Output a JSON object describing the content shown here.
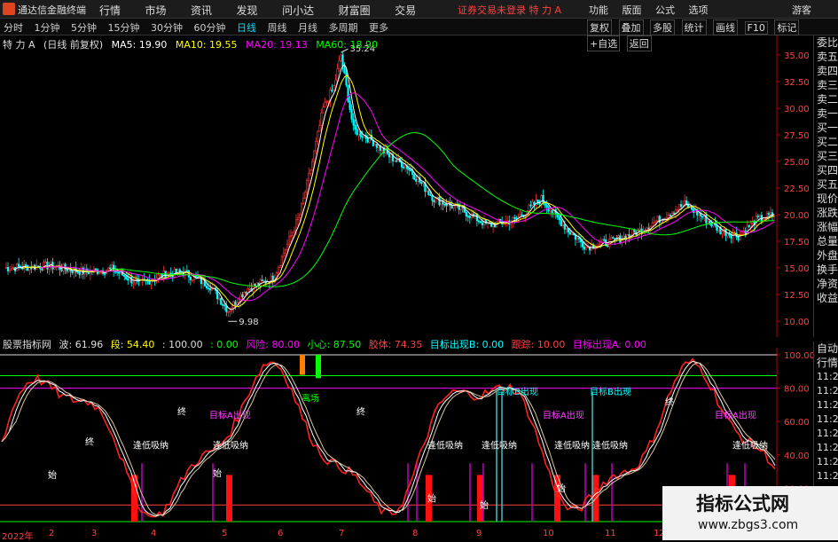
{
  "app": {
    "name": "通达信金融终端"
  },
  "menu": [
    "行情",
    "市场",
    "资讯",
    "发现",
    "问小达",
    "财富圈",
    "交易"
  ],
  "login_status": "证券交易未登录  特 力 A",
  "right_menu": [
    "功能",
    "版面",
    "公式",
    "选项"
  ],
  "guest": "游客",
  "periods": [
    "分时",
    "1分钟",
    "5分钟",
    "15分钟",
    "30分钟",
    "60分钟",
    "日线",
    "周线",
    "月线",
    "多周期",
    "更多"
  ],
  "active_period": "日线",
  "tool_buttons": [
    "复权",
    "叠加",
    "多股",
    "统计",
    "画线",
    "F10",
    "标记",
    "+自选",
    "返回"
  ],
  "main_info": {
    "stock": "特 力 A",
    "adjust": "(日线 前复权)",
    "ma5": "MA5: 19.90",
    "ma10": "MA10: 19.55",
    "ma20": "MA20: 19.13",
    "ma60": "MA60: 18.90"
  },
  "colors": {
    "up": "#ff3030",
    "down": "#00ffff",
    "ma5": "#ffffff",
    "ma10": "#ffff00",
    "ma20": "#ff00ff",
    "ma60": "#00ff00",
    "axis": "#ff4040"
  },
  "price_axis": [
    "35.00",
    "32.50",
    "30.00",
    "27.50",
    "25.00",
    "22.50",
    "20.00",
    "17.50",
    "15.00",
    "12.50",
    "10.00"
  ],
  "price_annotations": {
    "high": "35.24",
    "low": "9.98"
  },
  "indicator_info": {
    "name": "股票指标网",
    "b": "波: 61.96",
    "d": "段: 54.40",
    "v100": ": 100.00",
    "v0": ": 0.00",
    "risk": "风险: 80.00",
    "careful": "小心: 87.50",
    "escape": "胶体: 74.35",
    "targetB": "目标出现B: 0.00",
    "dot": "跟踪: 10.00",
    "targetA": "目标出现A: 0.00"
  },
  "ind_axis": [
    "100.00",
    "80.00",
    "60.00",
    "40.00",
    "20.00"
  ],
  "ind_labels": {
    "target_a": "目标A出现",
    "target_b": "目标B出现",
    "buy_low": "逢低吸纳",
    "escape": "离场",
    "start": "始",
    "end": "终"
  },
  "side_panel": [
    "委比",
    "卖五",
    "卖四",
    "卖三",
    "卖二",
    "卖一",
    "买一",
    "买二",
    "买三",
    "买四",
    "买五",
    "现价",
    "涨跌",
    "涨幅",
    "总量",
    "外盘",
    "换手",
    "净资",
    "收益"
  ],
  "side_panel2": [
    "自动",
    "行情"
  ],
  "side_times": [
    "11:26",
    "11:26",
    "11:26",
    "11:27",
    "11:27",
    "11:27",
    "11:27",
    "11:27"
  ],
  "x_axis": [
    "2022年",
    "2",
    "3",
    "4",
    "5",
    "6",
    "7",
    "8",
    "9",
    "10",
    "11",
    "12"
  ],
  "watermark": {
    "title": "指标公式网",
    "url": "www.zbgs3.com"
  }
}
